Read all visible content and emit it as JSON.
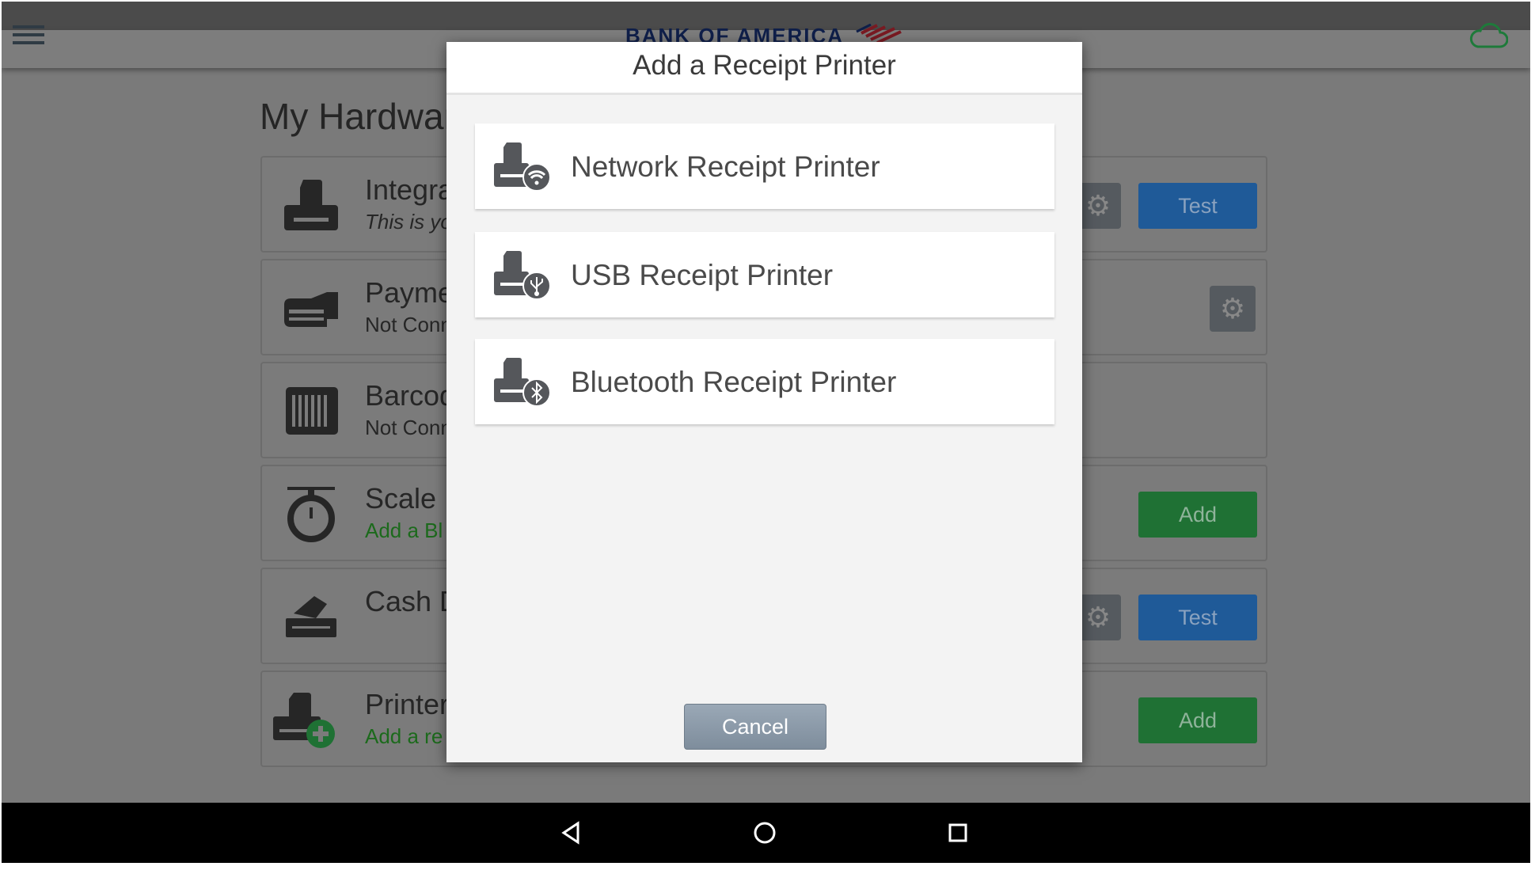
{
  "app": {
    "logo_text": "BANK OF AMERICA",
    "page_title": "My Hardware",
    "colors": {
      "accent_blue": "#1f5a98",
      "accent_green": "#1f7134",
      "cloud_green": "#1e7a3a"
    }
  },
  "rows": [
    {
      "title": "Integra",
      "subtitle": "This is yo",
      "icon": "printer-icon",
      "button": "Test",
      "gear": true
    },
    {
      "title": "Payme",
      "subtitle": "Not Conn",
      "icon": "card-reader-icon",
      "gear": true
    },
    {
      "title": "Barcod",
      "subtitle": "Not Conn",
      "icon": "barcode-icon"
    },
    {
      "title": "Scale",
      "subtitle": "Add a Bl",
      "icon": "scale-icon",
      "button": "Add"
    },
    {
      "title": "Cash D",
      "subtitle": "",
      "icon": "cash-drawer-icon",
      "button": "Test",
      "gear": true
    },
    {
      "title": "Printer",
      "subtitle": "Add a re",
      "icon": "printer-add-icon",
      "button": "Add"
    }
  ],
  "modal": {
    "title": "Add a Receipt Printer",
    "options": [
      {
        "label": "Network Receipt Printer",
        "icon": "network-printer-icon"
      },
      {
        "label": "USB Receipt Printer",
        "icon": "usb-printer-icon"
      },
      {
        "label": "Bluetooth Receipt Printer",
        "icon": "bluetooth-printer-icon"
      }
    ],
    "cancel_label": "Cancel"
  },
  "navbar": {
    "icons": [
      "back-icon",
      "home-icon",
      "recents-icon"
    ]
  }
}
